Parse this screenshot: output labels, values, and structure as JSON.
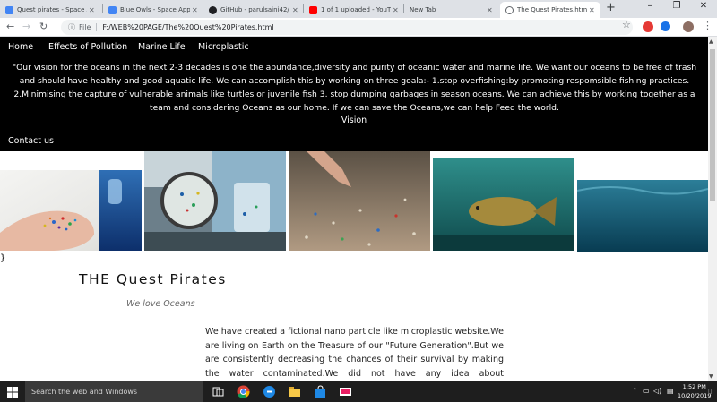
{
  "browser": {
    "tabs": [
      {
        "label": "Quest pirates - Space A",
        "favicon_color": "#4285f4"
      },
      {
        "label": "Blue Owls - Space Appl",
        "favicon_color": "#4285f4"
      },
      {
        "label": "GitHub - parulsaini42/",
        "favicon_color": "#202124"
      },
      {
        "label": "1 of 1 uploaded - YouT",
        "favicon_color": "#ff0000"
      },
      {
        "label": "New Tab",
        "favicon_color": "#dee1e6"
      },
      {
        "label": "The Quest Pirates.html",
        "favicon_color": "#5f6368"
      }
    ],
    "active_tab": 5,
    "address": {
      "scheme_label": "File",
      "url": "F:/WEB%20PAGE/The%20Quest%20Pirates.html"
    }
  },
  "page": {
    "nav": [
      {
        "label": "Home"
      },
      {
        "label": "Effects of Pollution"
      },
      {
        "label": "Marine Life"
      },
      {
        "label": "Microplastic"
      }
    ],
    "vision_text": "\"Our vision for the oceans in the next 2-3 decades is one the abundance,diversity and purity of oceanic water and marine life. We want our oceans to be free of trash and should have healthy and good aquatic life. We can accomplish this by working on three goala:- 1.stop overfishing:by promoting respomsible fishing practices. 2.Minimising the capture of vulnerable animals like turtles or juvenile fish 3. stop dumping garbages in season oceans. We can achieve this by working together as a team and considering Oceans as our home. If we can save the Oceans,we can help Feed the world.",
    "vision_label": "Vision",
    "contact_label": "Contact us",
    "stray_text": "}",
    "title": "THE Quest Pirates",
    "subtitle": "We love Oceans",
    "body_text": "We have created a fictional nano particle like microplastic website.We are living on Earth on the Treasure of our \"Future Generation\".But we are consistently decreasing the chances of their survival by making the water contaminated.We did not have any idea about microplastics present in oceans and other watery bodies.Do you know,on just drinking water from"
  },
  "taskbar": {
    "search_placeholder": "Search the web and Windows",
    "time": "1:52 PM",
    "date": "10/20/2019"
  },
  "colors": {
    "header_bg": "#000000",
    "taskbar_bg": "#1e1e1e"
  }
}
